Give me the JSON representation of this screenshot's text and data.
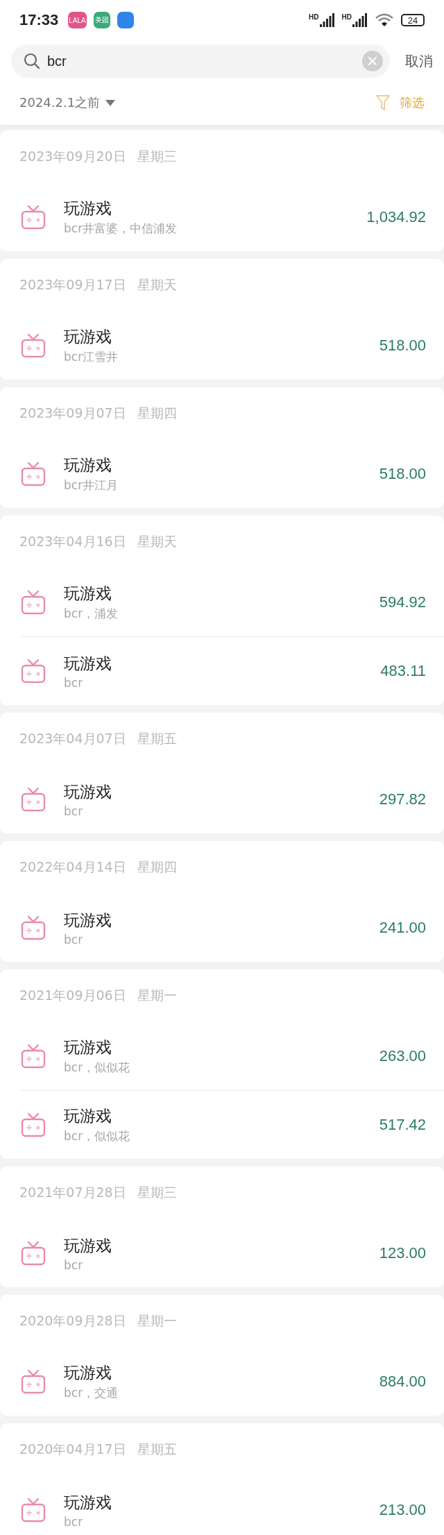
{
  "status_bar": {
    "time": "17:33",
    "notifications": [
      {
        "label": "LALA",
        "color": "#e0558a"
      },
      {
        "label": "美团",
        "color": "#3aaa78"
      },
      {
        "color": "#2f86e8"
      }
    ],
    "signal_labels": [
      "HD",
      "HD"
    ],
    "battery": "24"
  },
  "search": {
    "value": "bcr",
    "cancel": "取消"
  },
  "filter_bar": {
    "date_range": "2024.2.1之前",
    "filter": "筛选"
  },
  "groups": [
    {
      "date": "2023年09月20日",
      "weekday": "星期三",
      "items": [
        {
          "title": "玩游戏",
          "note": "bcr井富婆，中信浦发",
          "amount": "1,034.92"
        }
      ]
    },
    {
      "date": "2023年09月17日",
      "weekday": "星期天",
      "items": [
        {
          "title": "玩游戏",
          "note": "bcr江雪井",
          "amount": "518.00"
        }
      ]
    },
    {
      "date": "2023年09月07日",
      "weekday": "星期四",
      "items": [
        {
          "title": "玩游戏",
          "note": "bcr井江月",
          "amount": "518.00"
        }
      ]
    },
    {
      "date": "2023年04月16日",
      "weekday": "星期天",
      "items": [
        {
          "title": "玩游戏",
          "note": "bcr，浦发",
          "amount": "594.92"
        },
        {
          "title": "玩游戏",
          "note": "bcr",
          "amount": "483.11"
        }
      ]
    },
    {
      "date": "2023年04月07日",
      "weekday": "星期五",
      "items": [
        {
          "title": "玩游戏",
          "note": "bcr",
          "amount": "297.82"
        }
      ]
    },
    {
      "date": "2022年04月14日",
      "weekday": "星期四",
      "items": [
        {
          "title": "玩游戏",
          "note": "bcr",
          "amount": "241.00"
        }
      ]
    },
    {
      "date": "2021年09月06日",
      "weekday": "星期一",
      "items": [
        {
          "title": "玩游戏",
          "note": "bcr，似似花",
          "amount": "263.00"
        },
        {
          "title": "玩游戏",
          "note": "bcr，似似花",
          "amount": "517.42"
        }
      ]
    },
    {
      "date": "2021年07月28日",
      "weekday": "星期三",
      "items": [
        {
          "title": "玩游戏",
          "note": "bcr",
          "amount": "123.00"
        }
      ]
    },
    {
      "date": "2020年09月28日",
      "weekday": "星期一",
      "items": [
        {
          "title": "玩游戏",
          "note": "bcr，交通",
          "amount": "884.00"
        }
      ]
    },
    {
      "date": "2020年04月17日",
      "weekday": "星期五",
      "items": [
        {
          "title": "玩游戏",
          "note": "bcr",
          "amount": "213.00"
        }
      ]
    }
  ]
}
